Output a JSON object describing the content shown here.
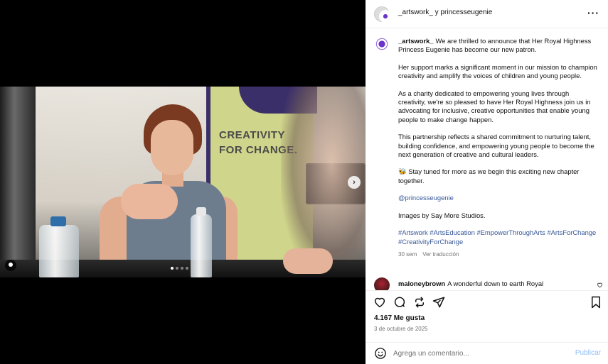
{
  "header": {
    "title": "_artswork_ y princesseugenie",
    "more_icon": "more-horizontal-icon"
  },
  "media": {
    "banner_line1": "CREATIVITY",
    "banner_line2": "FOR CHANGE.",
    "carousel_total": 4,
    "carousel_active": 1
  },
  "caption": {
    "username": "_artswork_",
    "p1": "We are thrilled to announce that Her Royal Highness Princess Eugenie has become our new patron.",
    "p2": "Her support marks a significant moment in our mission to champion creativity and amplify the voices of children and young people.",
    "p3": "As a charity dedicated to empowering young lives through creativity, we're so pleased to have Her Royal Highness join us in advocating for inclusive, creative opportunities that enable young people to make change happen.",
    "p4": "This partnership reflects a shared commitment to nurturing talent, building confidence, and empowering young people to become the next generation of creative and cultural leaders.",
    "p5": "🐝 Stay tuned for more as we begin this exciting new chapter together.",
    "mention": "@princesseugenie",
    "credit": "Images by Say More Studios.",
    "hashtags": "#Artswork #ArtsEducation #EmpowerThroughArts #ArtsForChange #CreativityForChange",
    "age": "30 sem",
    "translate": "Ver traducción"
  },
  "comment": {
    "username": "maloneybrown",
    "text": "A wonderful down to earth Royal"
  },
  "stats": {
    "likes": "4.167 Me gusta",
    "date": "3 de octubre de 2025"
  },
  "add_comment": {
    "placeholder": "Agrega un comentario...",
    "post_label": "Publicar"
  },
  "colors": {
    "link": "#385898",
    "post_button": "#8fbef7",
    "brand_purple": "#6b33c9"
  }
}
